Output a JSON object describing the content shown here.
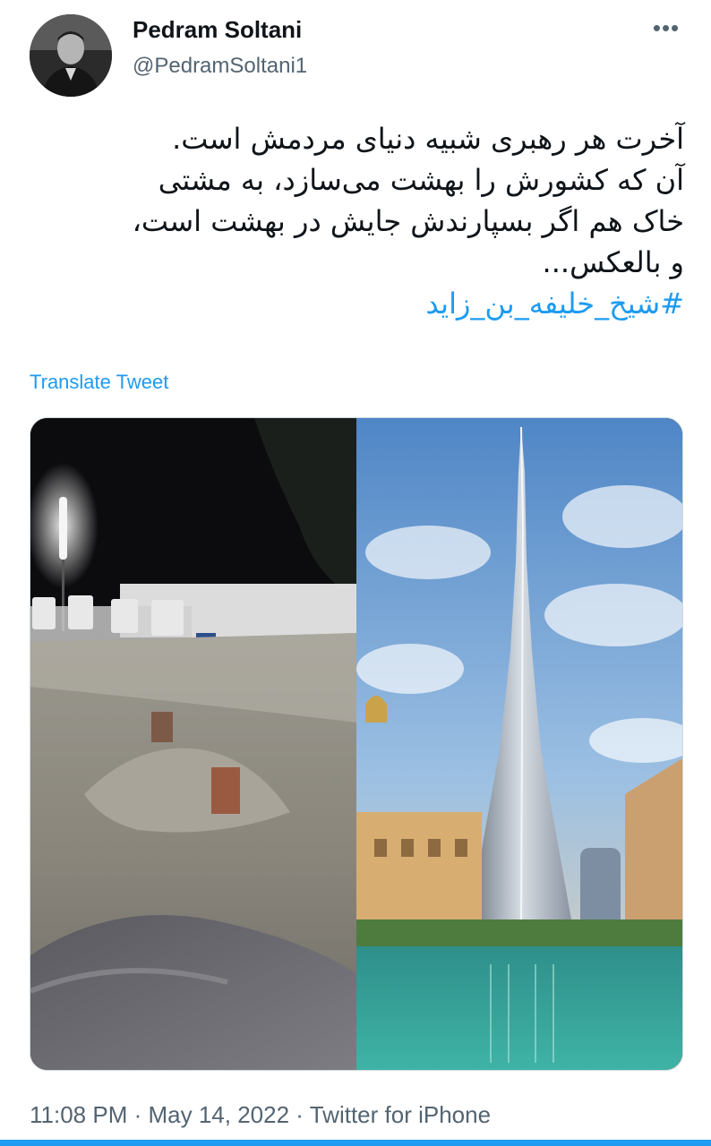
{
  "author": {
    "display_name": "Pedram Soltani",
    "handle": "@PedramSoltani1"
  },
  "more_menu": "•••",
  "tweet": {
    "lines": [
      "آخرت هر رهبری شبیه دنیای مردمش است.",
      "آن که کشورش را بهشت می‌سازد، به مشتی",
      "خاک هم اگر بسپارندش جایش در بهشت است،",
      "و بالعکس..."
    ],
    "hashtag": "#شیخ_خلیفه_بن_زاید"
  },
  "translate_label": "Translate Tweet",
  "meta": {
    "time": "11:08 PM",
    "date": "May 14, 2022",
    "source": "Twitter for iPhone",
    "separator": "·"
  },
  "colors": {
    "link": "#1d9bf0",
    "secondary_text": "#536471",
    "primary_text": "#0f1419"
  }
}
